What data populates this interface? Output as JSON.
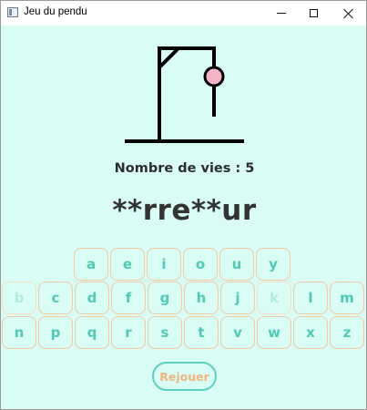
{
  "window": {
    "title": "Jeu du pendu"
  },
  "game": {
    "lives_text": "Nombre de vies : 5",
    "masked_word": "**rre**ur",
    "replay_label": "Rejouer"
  },
  "keyboard": {
    "row1": [
      {
        "letter": "a",
        "used": false
      },
      {
        "letter": "e",
        "used": false
      },
      {
        "letter": "i",
        "used": false
      },
      {
        "letter": "o",
        "used": false
      },
      {
        "letter": "u",
        "used": false
      },
      {
        "letter": "y",
        "used": false
      }
    ],
    "row2": [
      {
        "letter": "b",
        "used": true
      },
      {
        "letter": "c",
        "used": false
      },
      {
        "letter": "d",
        "used": false
      },
      {
        "letter": "f",
        "used": false
      },
      {
        "letter": "g",
        "used": false
      },
      {
        "letter": "h",
        "used": false
      },
      {
        "letter": "j",
        "used": false
      },
      {
        "letter": "k",
        "used": true
      },
      {
        "letter": "l",
        "used": false
      },
      {
        "letter": "m",
        "used": false
      }
    ],
    "row3": [
      {
        "letter": "n",
        "used": false
      },
      {
        "letter": "p",
        "used": false
      },
      {
        "letter": "q",
        "used": false
      },
      {
        "letter": "r",
        "used": false
      },
      {
        "letter": "s",
        "used": false
      },
      {
        "letter": "t",
        "used": false
      },
      {
        "letter": "v",
        "used": false
      },
      {
        "letter": "w",
        "used": false
      },
      {
        "letter": "x",
        "used": false
      },
      {
        "letter": "z",
        "used": false
      }
    ]
  },
  "colors": {
    "background": "#d9fdf5",
    "key_text": "#52c9b7",
    "key_border": "#f3c8a4",
    "head": "#f7b3c6",
    "replay_text": "#f0b47e"
  },
  "icons": {
    "minimize": "minimize-icon",
    "maximize": "maximize-icon",
    "close": "close-icon"
  }
}
